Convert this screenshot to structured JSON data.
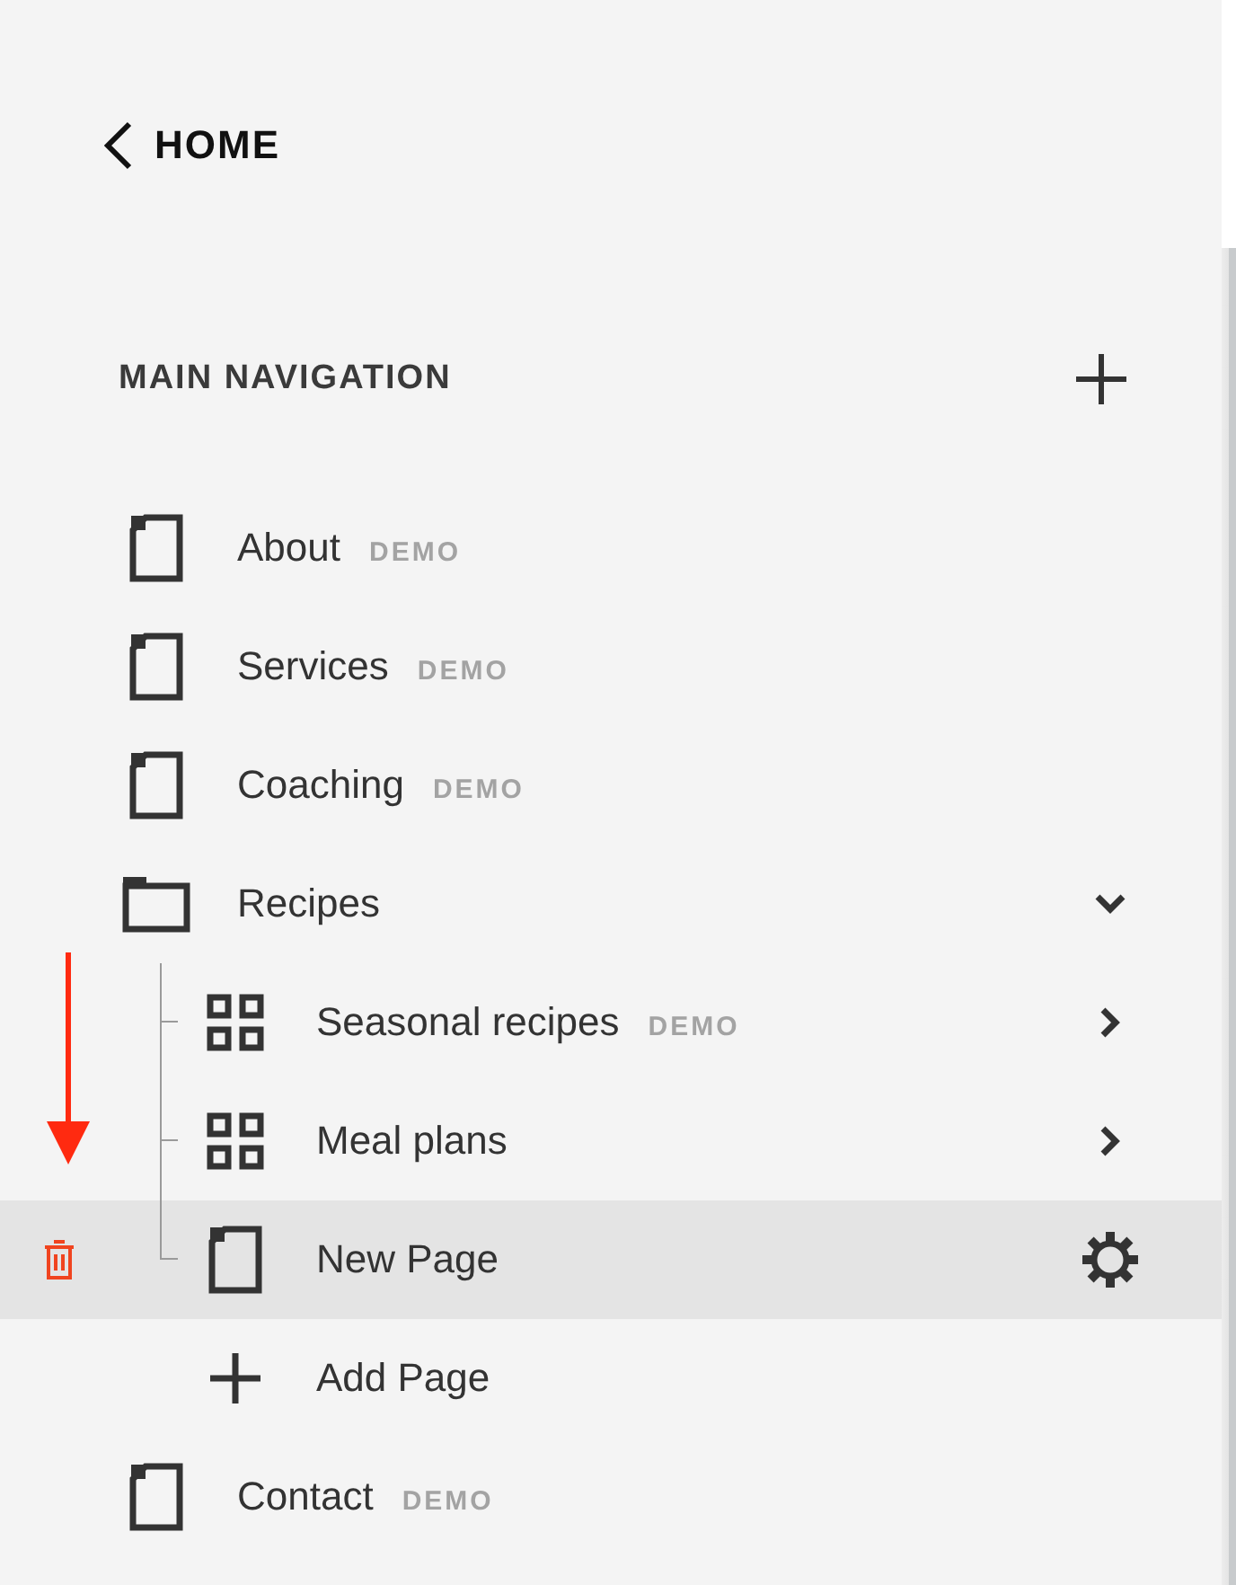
{
  "back": {
    "label": "HOME"
  },
  "section": {
    "title": "MAIN NAVIGATION"
  },
  "items": [
    {
      "kind": "page",
      "label": "About",
      "badge": "DEMO",
      "selected": false
    },
    {
      "kind": "page",
      "label": "Services",
      "badge": "DEMO",
      "selected": false
    },
    {
      "kind": "page",
      "label": "Coaching",
      "badge": "DEMO",
      "selected": false
    },
    {
      "kind": "folder",
      "label": "Recipes",
      "selected": false,
      "expanded": true,
      "children": [
        {
          "kind": "collection",
          "label": "Seasonal recipes",
          "badge": "DEMO",
          "selected": false
        },
        {
          "kind": "collection",
          "label": "Meal plans",
          "selected": false
        },
        {
          "kind": "page",
          "label": "New Page",
          "selected": true
        },
        {
          "kind": "add",
          "label": "Add Page",
          "selected": false
        }
      ]
    },
    {
      "kind": "page",
      "label": "Contact",
      "badge": "DEMO",
      "selected": false
    }
  ]
}
